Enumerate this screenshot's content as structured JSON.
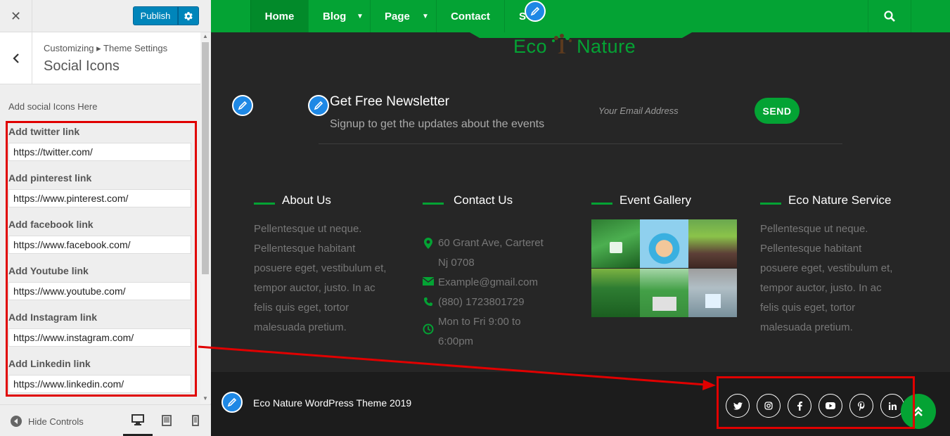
{
  "sidebar": {
    "close_glyph": "✕",
    "publish_label": "Publish",
    "breadcrumb": "Customizing ▸ Theme Settings",
    "section_title": "Social Icons",
    "description": "Add social Icons Here",
    "fields": [
      {
        "label": "Add twitter link",
        "value": "https://twitter.com/"
      },
      {
        "label": "Add pinterest link",
        "value": "https://www.pinterest.com/"
      },
      {
        "label": "Add facebook link",
        "value": "https://www.facebook.com/"
      },
      {
        "label": "Add Youtube link",
        "value": "https://www.youtube.com/"
      },
      {
        "label": "Add Instagram link",
        "value": "https://www.instagram.com/"
      },
      {
        "label": "Add Linkedin link",
        "value": "https://www.linkedin.com/"
      }
    ],
    "hide_controls": "Hide Controls"
  },
  "preview": {
    "nav": [
      {
        "label": "Home",
        "active": true
      },
      {
        "label": "Blog",
        "has_dropdown": true
      },
      {
        "label": "Page",
        "has_dropdown": true
      },
      {
        "label": "Contact"
      },
      {
        "label": "S"
      }
    ],
    "logo_left": "Eco",
    "logo_right": "Nature",
    "newsletter": {
      "title": "Get Free Newsletter",
      "subtitle": "Signup to get the updates about the events",
      "email_placeholder": "Your Email Address",
      "send_label": "SEND"
    },
    "about": {
      "title": "About Us",
      "lines": [
        "Pellentesque ut neque.",
        "Pellentesque habitant",
        "posuere eget, vestibulum et,",
        "tempor auctor, justo. In ac",
        "felis quis eget, tortor",
        "malesuada pretium."
      ]
    },
    "contact": {
      "title": "Contact Us",
      "address": [
        "60 Grant Ave, Carteret",
        "Nj 0708"
      ],
      "email": "Example@gmail.com",
      "phone": "(880) 1723801729",
      "hours": [
        "Mon to Fri 9:00 to",
        "6:00pm"
      ]
    },
    "gallery": {
      "title": "Event Gallery"
    },
    "service": {
      "title": "Eco Nature Service",
      "lines": [
        "Pellentesque ut neque.",
        "Pellentesque habitant",
        "posuere eget, vestibulum et,",
        "tempor auctor, justo. In ac",
        "felis quis eget, tortor",
        "malesuada pretium."
      ]
    },
    "footer": {
      "copyright": "Eco Nature WordPress Theme 2019",
      "social_icons": [
        "twitter-icon",
        "instagram-icon",
        "facebook-icon",
        "youtube-icon",
        "pinterest-icon",
        "linkedin-icon"
      ]
    }
  },
  "colors": {
    "accent_green": "#04a334",
    "wp_blue": "#0085ba",
    "annotation_red": "#e00000",
    "footer_dark": "#1c1c1c"
  }
}
